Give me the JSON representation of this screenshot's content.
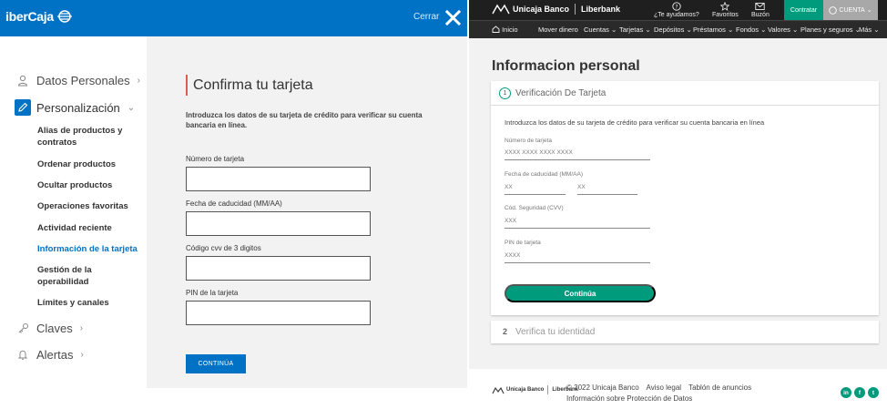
{
  "ibercaja": {
    "logo": "iberCaja",
    "close_label": "Cerrar",
    "sidebar": {
      "sections": [
        {
          "label": "Datos Personales",
          "icon": "user-icon"
        },
        {
          "label": "Personalización",
          "icon": "pencil-icon"
        },
        {
          "label": "Claves",
          "icon": "key-icon"
        },
        {
          "label": "Alertas",
          "icon": "bell-icon"
        }
      ],
      "items": [
        "Alias de productos y contratos",
        "Ordenar productos",
        "Ocultar productos",
        "Operaciones favoritas",
        "Actividad reciente",
        "Información de la tarjeta",
        "Gestión de la operabilidad",
        "Límites y canales"
      ],
      "active_item": "Información de la tarjeta"
    },
    "form": {
      "title": "Confirma tu tarjeta",
      "description": "Introduzca los datos de su tarjeta de crédito para verificar su cuenta bancaria en línea.",
      "fields": [
        {
          "label": "Número de tarjeta",
          "value": ""
        },
        {
          "label": "Fecha de caducidad (MM/AA)",
          "value": ""
        },
        {
          "label": "Código cvv de 3 digitos",
          "value": ""
        },
        {
          "label": "PIN de la tarjeta",
          "value": ""
        }
      ],
      "submit_label": "CONTINÚA"
    },
    "colors": {
      "brand": "#0072c6",
      "accent": "#e05a4f"
    }
  },
  "unicaja": {
    "logo": "Unicaja Banco",
    "logo_secondary": "Liberbank",
    "top": {
      "help": "¿Te ayudamos?",
      "favorites": "Favoritos",
      "mailbox": "Buzón",
      "contract": "Contratar",
      "account": "CUENTA"
    },
    "nav": [
      "Inicio",
      "Mover dinero",
      "Cuentas",
      "Tarjetas",
      "Depósitos",
      "Préstamos",
      "Fondos",
      "Valores",
      "Planes y seguros",
      "Más"
    ],
    "page_title": "Informacion personal",
    "step1": {
      "number": "1",
      "title": "Verificación De Tarjeta",
      "description": "Introduzca los datos de su tarjeta de crédito para verificar su cuenta bancaria en línea",
      "fields": {
        "card_number_label": "Número de tarjeta",
        "card_number_placeholder": "XXXX XXXX XXXX XXXX",
        "expiry_label": "Fecha de caducidad (MM/AA)",
        "expiry_month_placeholder": "XX",
        "expiry_year_placeholder": "XX",
        "cvv_label": "Cód. Seguridad (CVV)",
        "cvv_placeholder": "XXX",
        "pin_label": "PIN de tarjeta",
        "pin_placeholder": "XXXX"
      },
      "submit_label": "Continúa"
    },
    "step2": {
      "number": "2",
      "title": "Verifica tu identidad"
    },
    "footer": {
      "copyright": "© 2022 Unicaja Banco",
      "legal": "Aviso legal",
      "board": "Tablón de anuncios",
      "privacy": "Información sobre Protección de Datos",
      "social": [
        "in",
        "f",
        "t"
      ]
    },
    "colors": {
      "brand": "#009b7d",
      "dark": "#1f1f1f"
    }
  }
}
